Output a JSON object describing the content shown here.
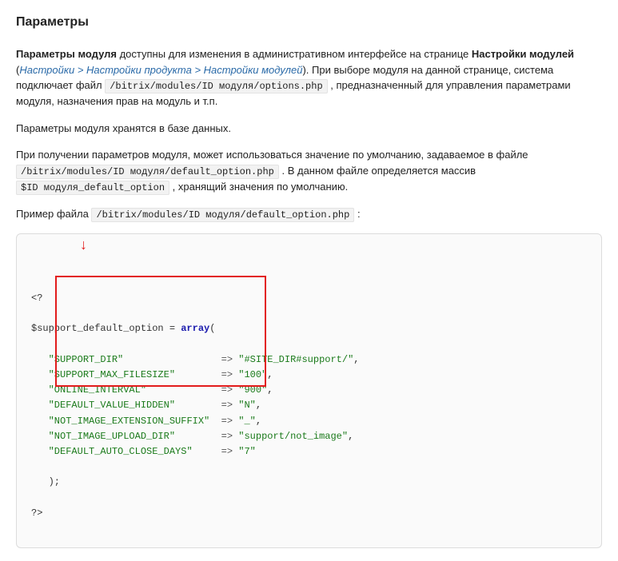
{
  "heading": "Параметры",
  "para1": {
    "t1": "Параметры модуля",
    "t2": " доступны для изменения в административном интерфейсе на странице ",
    "t3": "Настройки модулей",
    "t4": " (",
    "link": "Настройки > Настройки продукта > Настройки модулей",
    "t5": "). При выборе модуля на данной странице, система подключает файл ",
    "code1": "/bitrix/modules/ID модуля/options.php",
    "t6": " , предназначенный для управления параметрами модуля, назначения прав на модуль и т.п."
  },
  "para2": "Параметры модуля хранятся в базе данных.",
  "para3": {
    "t1": "При получении параметров модуля, может использоваться значение по умолчанию, задаваемое в файле ",
    "code1": "/bitrix/modules/ID модуля/default_option.php",
    "t2": " . В данном файле определяется массив ",
    "code2": "$ID модуля_default_option",
    "t3": " , хранящий значения по умолчанию."
  },
  "para4": {
    "t1": "Пример файла ",
    "code1": "/bitrix/modules/ID модуля/default_option.php",
    "t2": " :"
  },
  "code": {
    "l1a": "<?",
    "l2a": "$support_default_option = ",
    "l2kw": "array",
    "l2b": "(",
    "rows": [
      {
        "key": "\"SUPPORT_DIR\"",
        "arrow": "=>",
        "val": "\"#SITE_DIR#support/\"",
        "comma": ","
      },
      {
        "key": "\"SUPPORT_MAX_FILESIZE\"",
        "arrow": "=>",
        "val": "\"100\"",
        "comma": ","
      },
      {
        "key": "\"ONLINE_INTERVAL\"",
        "arrow": "=>",
        "val": "\"900\"",
        "comma": ","
      },
      {
        "key": "\"DEFAULT_VALUE_HIDDEN\"",
        "arrow": "=>",
        "val": "\"N\"",
        "comma": ","
      },
      {
        "key": "\"NOT_IMAGE_EXTENSION_SUFFIX\"",
        "arrow": "=>",
        "val": "\"_\"",
        "comma": ","
      },
      {
        "key": "\"NOT_IMAGE_UPLOAD_DIR\"",
        "arrow": "=>",
        "val": "\"support/not_image\"",
        "comma": ","
      },
      {
        "key": "\"DEFAULT_AUTO_CLOSE_DAYS\"",
        "arrow": "=>",
        "val": "\"7\"",
        "comma": ""
      }
    ],
    "l_end1": "   );",
    "l_end2": "?>"
  }
}
